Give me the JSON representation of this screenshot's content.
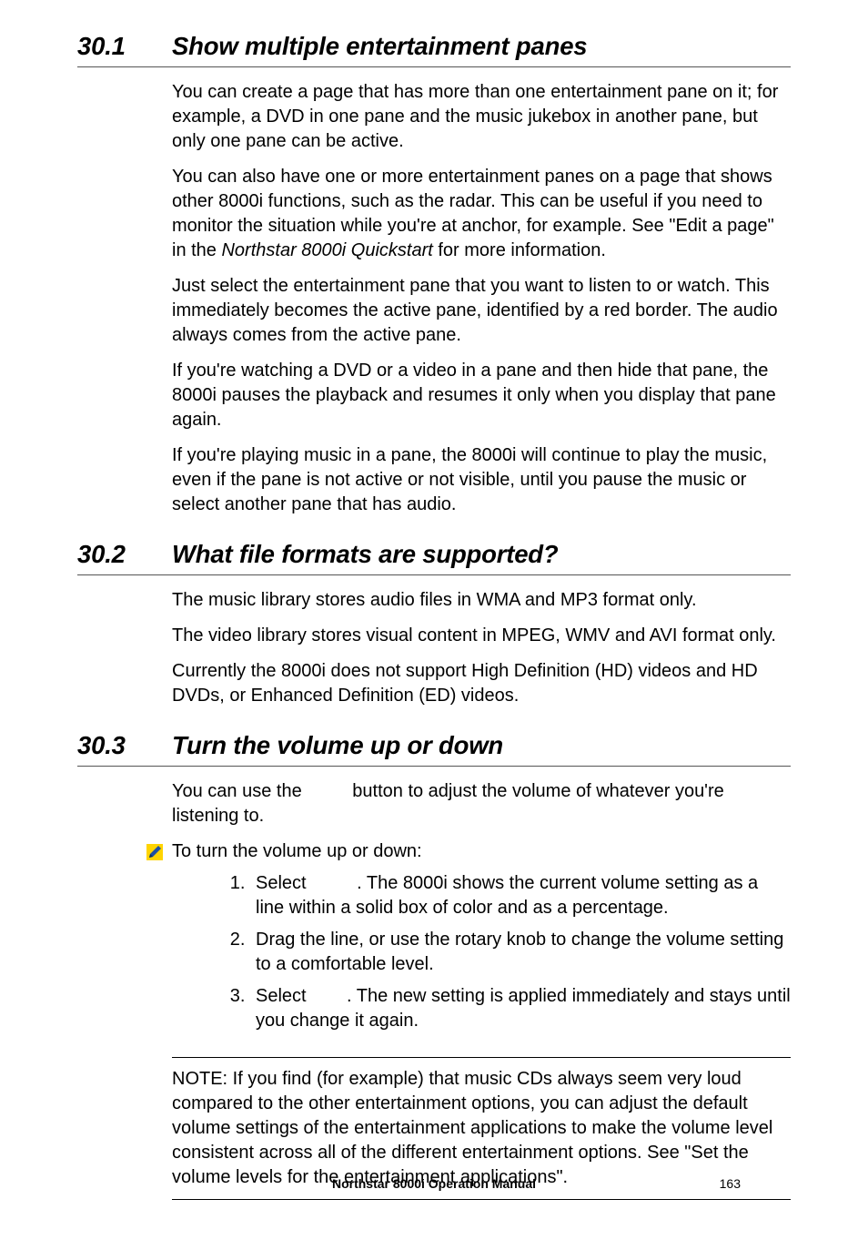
{
  "sections": [
    {
      "num": "30.1",
      "title": "Show multiple entertainment panes",
      "paras": [
        "You can create a page that has more than one entertainment pane on it; for example, a DVD in one pane and the music jukebox in another pane, but only one pane can be active.",
        "",
        "Just select the entertainment pane that you want to listen to or watch. This immediately becomes the active pane, identified by a red border. The audio always comes from the active pane.",
        "If you're watching a DVD or a video in a pane and then hide that pane, the 8000i pauses the playback and resumes it only when you display that pane again.",
        " If you're playing music in a pane, the 8000i will continue to play the music, even if the pane is not active or not visible, until you pause the music or select another pane that has audio."
      ],
      "para2_pre": "You can also have one or more entertainment panes on a page that shows other 8000i functions, such as the radar. This can be useful if you need to monitor the situation while you're at anchor, for example. See \"Edit a page\" in the ",
      "para2_em": "Northstar 8000i Quickstart",
      "para2_post": " for more information."
    },
    {
      "num": "30.2",
      "title": "What file formats are supported?",
      "paras": [
        "The music library stores audio files in WMA and MP3 format only.",
        "The video library stores visual content in MPEG, WMV and AVI format only.",
        "Currently the 8000i does not support High Definition (HD) videos and HD DVDs, or Enhanced Definition (ED) videos."
      ]
    },
    {
      "num": "30.3",
      "title": "Turn the volume up or down",
      "lead": "You can use the          button to adjust the volume of whatever you're listening to.",
      "proc_lead": "To turn the volume up or down:",
      "steps": [
        "Select          . The 8000i shows the current volume setting as a line within a solid box of color and as a percentage.",
        "Drag the line, or use the rotary knob to change the volume setting to a comfortable level.",
        "Select        . The new setting is applied immediately and stays until you change it again."
      ],
      "note": "NOTE: If you find (for example) that music CDs always seem very loud compared to the other entertainment options, you can adjust the default volume settings of the entertainment applications to make the volume level consistent across all of the different entertainment options. See \"Set the volume levels for the entertainment applications\"."
    }
  ],
  "footer": {
    "title": "Northstar 8000i Operation Manual",
    "page": "163"
  }
}
